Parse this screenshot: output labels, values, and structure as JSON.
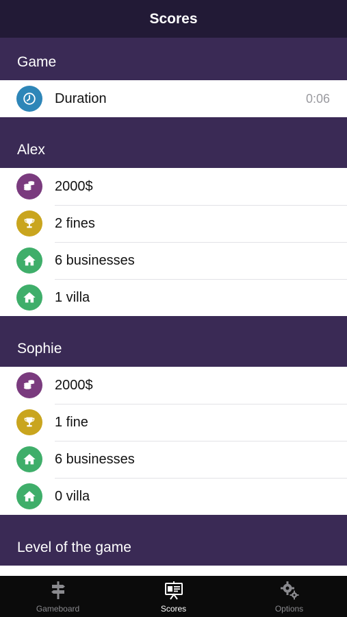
{
  "navbar": {
    "title": "Scores"
  },
  "sections": {
    "game": {
      "header": "Game",
      "duration_label": "Duration",
      "duration_value": "0:06"
    },
    "alex": {
      "header": "Alex",
      "money": "2000$",
      "fines": "2 fines",
      "businesses": "6 businesses",
      "villas": "1 villa"
    },
    "sophie": {
      "header": "Sophie",
      "money": "2000$",
      "fines": "1 fine",
      "businesses": "6 businesses",
      "villas": "0 villa"
    },
    "level": {
      "header": "Level of the game"
    }
  },
  "tabbar": {
    "tabs": [
      {
        "label": "Gameboard",
        "icon": "signpost-icon",
        "active": false
      },
      {
        "label": "Scores",
        "icon": "presentation-board-icon",
        "active": true
      },
      {
        "label": "Options",
        "icon": "gears-icon",
        "active": false
      }
    ]
  },
  "colors": {
    "navbar": "#221a36",
    "section_bg": "#3a2a55",
    "clock_icon": "#2e86b8",
    "money_icon": "#7a3b7e",
    "trophy_icon": "#c9a51e",
    "house_icon": "#3fae6a",
    "tabbar": "#0b0b0b"
  }
}
